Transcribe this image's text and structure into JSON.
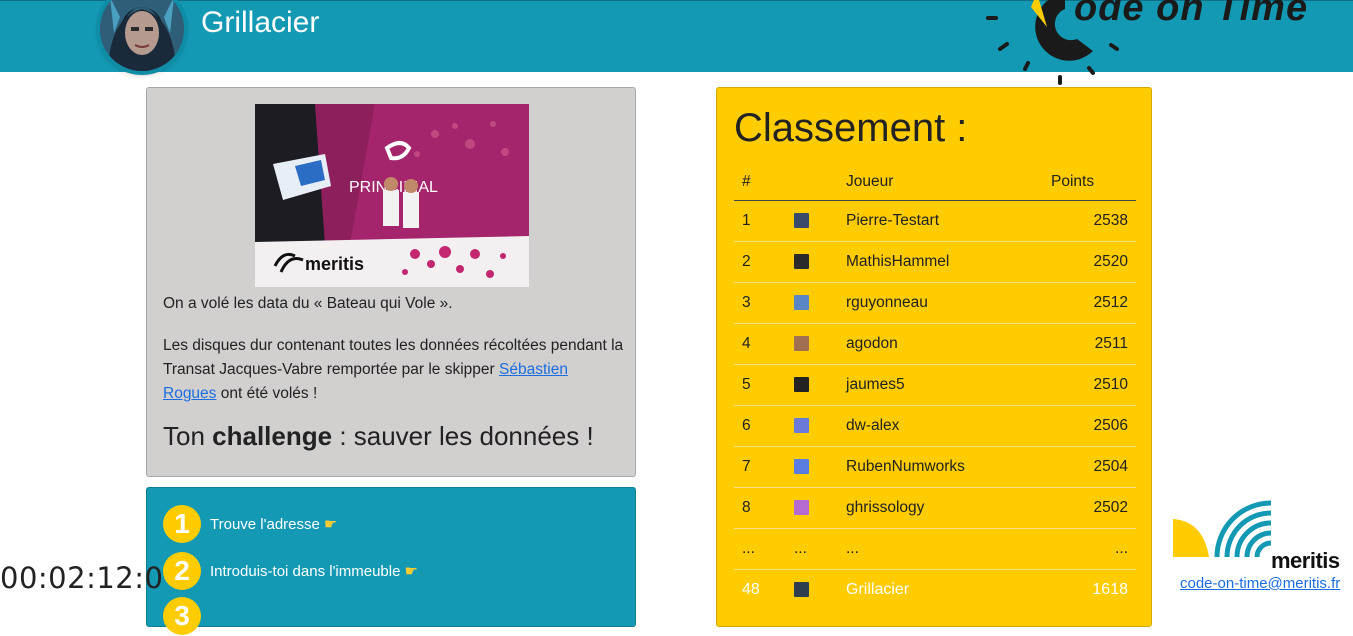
{
  "header": {
    "username": "Grillacier",
    "brand": "ode on Time",
    "colors": {
      "bar": "#1399b4",
      "brand_text": "#1a1a1a"
    }
  },
  "intro": {
    "paragraph1": "On a volé les data du « Bateau qui Vole ».",
    "paragraph2_before": "Les disques dur contenant toutes les données récoltées pendant la Transat Jacques-Vabre remportée par le skipper ",
    "paragraph2_link": "Sébastien Rogues",
    "paragraph2_after": " ont été volés !",
    "challenge_pre": "Ton ",
    "challenge_bold": "challenge",
    "challenge_post": " : sauver les données !",
    "photo": {
      "sail_text": "PRINCIPIAL",
      "hull_text": "meritis"
    }
  },
  "steps": [
    {
      "number": "1",
      "label": "Trouve l'adresse",
      "icon": "pointing-hand-icon"
    },
    {
      "number": "2",
      "label": "Introduis-toi dans l'immeuble",
      "icon": "pointing-hand-icon"
    },
    {
      "number": "3",
      "label": "",
      "icon": ""
    }
  ],
  "timer": "00:02:12:0",
  "ranking": {
    "title": "Classement :",
    "columns": {
      "rank": "#",
      "avatar": "",
      "player": "Joueur",
      "points": "Points"
    },
    "rows": [
      {
        "rank": "1",
        "player": "Pierre-Testart",
        "points": "2538",
        "avatar_color": "#3a4a6a"
      },
      {
        "rank": "2",
        "player": "MathisHammel",
        "points": "2520",
        "avatar_color": "#2b2b2b"
      },
      {
        "rank": "3",
        "player": "rguyonneau",
        "points": "2512",
        "avatar_color": "#5b86c4"
      },
      {
        "rank": "4",
        "player": "agodon",
        "points": "2511",
        "avatar_color": "#a07050"
      },
      {
        "rank": "5",
        "player": "jaumes5",
        "points": "2510",
        "avatar_color": "#222222"
      },
      {
        "rank": "6",
        "player": "dw-alex",
        "points": "2506",
        "avatar_color": "#6a7ad6"
      },
      {
        "rank": "7",
        "player": "RubenNumworks",
        "points": "2504",
        "avatar_color": "#5a7ce0"
      },
      {
        "rank": "8",
        "player": "ghrissology",
        "points": "2502",
        "avatar_color": "#b46ad0"
      },
      {
        "rank": "...",
        "player": "...",
        "points": "...",
        "avatar_color": "",
        "ellipsis": "..."
      },
      {
        "rank": "48",
        "player": "Grillacier",
        "points": "1618",
        "avatar_color": "#2e3e4e"
      }
    ]
  },
  "footer": {
    "logo_text": "meritis",
    "contact": "code-on-time@meritis.fr"
  },
  "colors": {
    "accent_blue": "#1399b4",
    "accent_yellow": "#ffcc00",
    "card_grey": "#d2cfcf",
    "link": "#1a6de0"
  }
}
